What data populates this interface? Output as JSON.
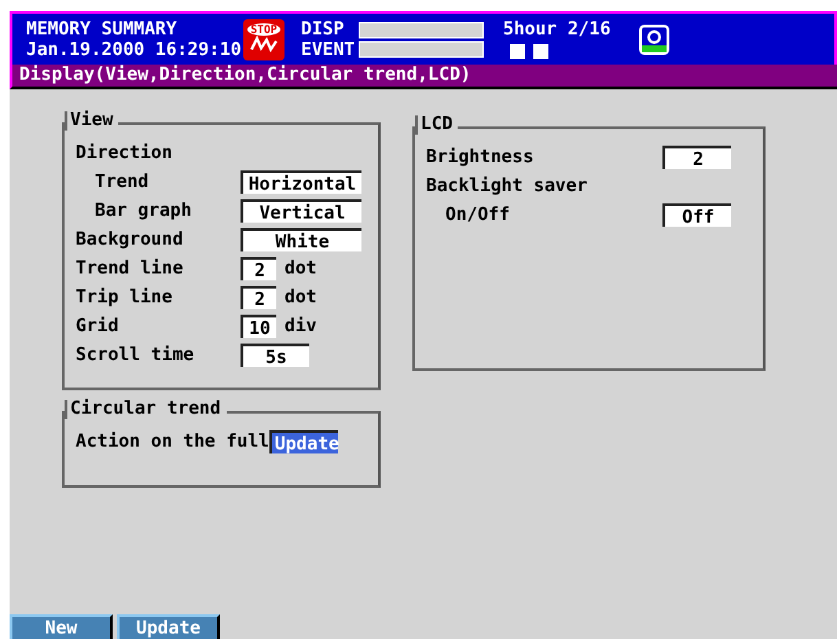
{
  "header": {
    "mode": "MEMORY SUMMARY",
    "datetime": "Jan.19.2000 16:29:10",
    "stop_label": "STOP",
    "disp_label": "DISP",
    "event_label": "EVENT",
    "timebase": "5hour 2/16"
  },
  "title_bar": "Display(View,Direction,Circular trend,LCD)",
  "columns": [
    {
      "groups": [
        {
          "title": "View",
          "items": [
            {
              "label": "Direction",
              "children": [
                {
                  "label": "Trend",
                  "value": "Horizontal",
                  "kind": "wide",
                  "selected": false
                },
                {
                  "label": "Bar graph",
                  "value": "Vertical",
                  "kind": "wide",
                  "selected": false
                }
              ]
            },
            {
              "label": "Background",
              "value": "White",
              "kind": "wide",
              "selected": false
            },
            {
              "label": "Trend line",
              "value": "2",
              "unit": "dot",
              "kind": "narrow",
              "selected": false
            },
            {
              "label": "Trip line",
              "value": "2",
              "unit": "dot",
              "kind": "narrow",
              "selected": false
            },
            {
              "label": "Grid",
              "value": "10",
              "unit": "div",
              "kind": "narrow",
              "selected": false
            },
            {
              "label": "Scroll time",
              "value": "5s",
              "kind": "medium",
              "selected": false
            }
          ]
        },
        {
          "title": "Circular trend",
          "items": [
            {
              "label": "Action on the full",
              "value": "Update",
              "kind": "medium",
              "selected": true
            }
          ]
        }
      ]
    },
    {
      "groups": [
        {
          "title": "LCD",
          "items": [
            {
              "label": "Brightness",
              "value": "2",
              "kind": "medium",
              "selected": false
            },
            {
              "label": "Backlight saver",
              "children": [
                {
                  "label": "On/Off",
                  "value": "Off",
                  "kind": "medium",
                  "selected": false
                }
              ]
            }
          ]
        }
      ]
    }
  ],
  "soft_keys": [
    {
      "label": "New"
    },
    {
      "label": "Update"
    }
  ]
}
